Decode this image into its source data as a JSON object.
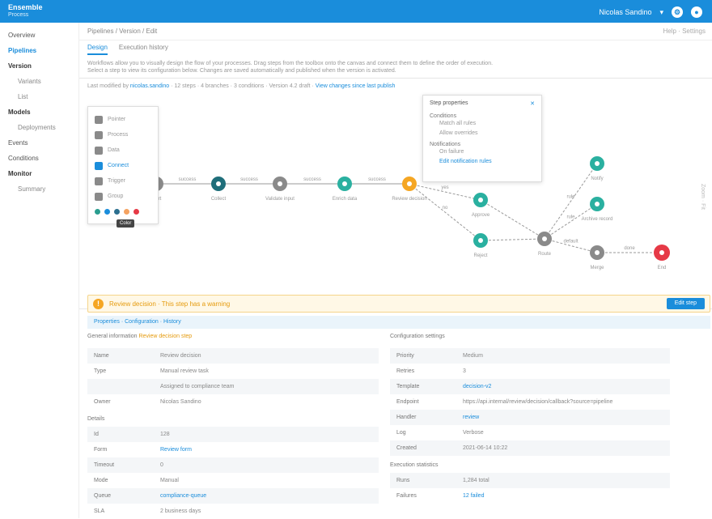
{
  "topbar": {
    "brand_line1": "Ensemble",
    "brand_line2": "Process",
    "user": "Nicolas Sandino",
    "settings_icon": "gear-icon",
    "user_icon": "user-icon"
  },
  "sidebar": {
    "items": [
      {
        "label": "Overview",
        "style": ""
      },
      {
        "label": "Pipelines",
        "style": "active"
      },
      {
        "label": "Version",
        "style": "strong"
      },
      {
        "label": "Variants",
        "style": "sub"
      },
      {
        "label": "List",
        "style": "sub"
      },
      {
        "label": "Models",
        "style": "strong"
      },
      {
        "label": "Deployments",
        "style": "sub"
      },
      {
        "label": "Events",
        "style": ""
      },
      {
        "label": "Conditions",
        "style": ""
      },
      {
        "label": "Monitor",
        "style": "strong"
      },
      {
        "label": "Summary",
        "style": "sub"
      }
    ]
  },
  "main": {
    "breadcrumb": "Pipelines / Version / Edit",
    "crumb_right": "Help · Settings",
    "tabs": [
      "Design",
      "Execution history"
    ],
    "description_1": "Workflows allow you to visually design the flow of your processes. Drag steps from the toolbox onto the canvas and connect them to define the order of execution.",
    "description_2": "Select a step to view its configuration below. Changes are saved automatically and published when the version is activated.",
    "flow_info_text": "Last modified by ",
    "flow_info_link": "nicolas.sandino",
    "flow_info_rest": "  ·  12 steps  ·  4 branches  ·  3 conditions  ·  Version 4.2 draft  ·  ",
    "flow_info_link2": "View changes since last publish"
  },
  "toolbox": {
    "items": [
      {
        "label": "Pointer",
        "selected": false
      },
      {
        "label": "Process",
        "selected": false
      },
      {
        "label": "Data",
        "selected": false
      },
      {
        "label": "Connect",
        "selected": true
      },
      {
        "label": "Trigger",
        "selected": false
      },
      {
        "label": "Group",
        "selected": false
      }
    ],
    "swatches": [
      "#2a9d8f",
      "#1a8ddb",
      "#2b6f8f",
      "#f4a261",
      "#e63946"
    ],
    "tooltip": "Color"
  },
  "popup": {
    "title": "Step properties",
    "section1": "Conditions",
    "s1_items": [
      "Match all rules",
      "Allow overrides"
    ],
    "section2": "Notifications",
    "s2_items": [
      "On failure",
      "Edit notification rules"
    ]
  },
  "flow_nodes": [
    {
      "label": "Start",
      "color": "#8a8a8a"
    },
    {
      "label": "Collect",
      "color": "#1f6e7a"
    },
    {
      "label": "Validate input",
      "color": "#8a8a8a"
    },
    {
      "label": "Enrich data",
      "color": "#2ab0a0"
    },
    {
      "label": "Review decision",
      "color": "#f5a623"
    },
    {
      "label": "Approve",
      "color": "#2ab0a0"
    },
    {
      "label": "Reject",
      "color": "#2ab0a0"
    },
    {
      "label": "Route",
      "color": "#8a8a8a"
    },
    {
      "label": "Notify",
      "color": "#2ab0a0"
    },
    {
      "label": "Archive record",
      "color": "#2ab0a0"
    },
    {
      "label": "Merge",
      "color": "#8a8a8a"
    },
    {
      "label": "End",
      "color": "#e63946"
    }
  ],
  "edge_labels": [
    "success",
    "success",
    "success",
    "success",
    "yes",
    "no",
    "rule",
    "rule",
    "default",
    "done"
  ],
  "side_labels": "Zoom · Fit",
  "alert": {
    "text": "Review decision  ·  This step has a warning",
    "button": "Edit step"
  },
  "subbar": "Properties  ·  Configuration  ·  History",
  "left_panel": {
    "title": "General information",
    "title_link": "Review decision step",
    "rows": [
      {
        "k": "Name",
        "v": "Review decision"
      },
      {
        "k": "Type",
        "v": "Manual review task"
      },
      {
        "k": "",
        "v": "Assigned to compliance team"
      },
      {
        "k": "Owner",
        "v": "Nicolas Sandino"
      }
    ],
    "section": "Details",
    "rows2": [
      {
        "k": "Id",
        "v": "128"
      },
      {
        "k": "Form",
        "v": "Review form",
        "link": true
      },
      {
        "k": "Timeout",
        "v": "0"
      },
      {
        "k": "Mode",
        "v": "Manual"
      },
      {
        "k": "Queue",
        "v": "compliance-queue",
        "link": true
      },
      {
        "k": "SLA",
        "v": "2 business days"
      }
    ]
  },
  "right_panel": {
    "title": "Configuration settings",
    "rows": [
      {
        "k": "Priority",
        "v": "Medium"
      },
      {
        "k": "Retries",
        "v": "3"
      },
      {
        "k": "Template",
        "v": "decision-v2",
        "link": true
      },
      {
        "k": "Endpoint",
        "v": "https://api.internal/review/decision/callback?source=pipeline"
      },
      {
        "k": "Handler",
        "v": "review",
        "link": true
      },
      {
        "k": "Log",
        "v": "Verbose"
      },
      {
        "k": "Created",
        "v": "2021-06-14 10:22"
      }
    ],
    "section": "Execution statistics",
    "rows2": [
      {
        "k": "Runs",
        "v": "1,284 total"
      },
      {
        "k": "Failures",
        "v": "12 failed",
        "link": true
      }
    ]
  }
}
